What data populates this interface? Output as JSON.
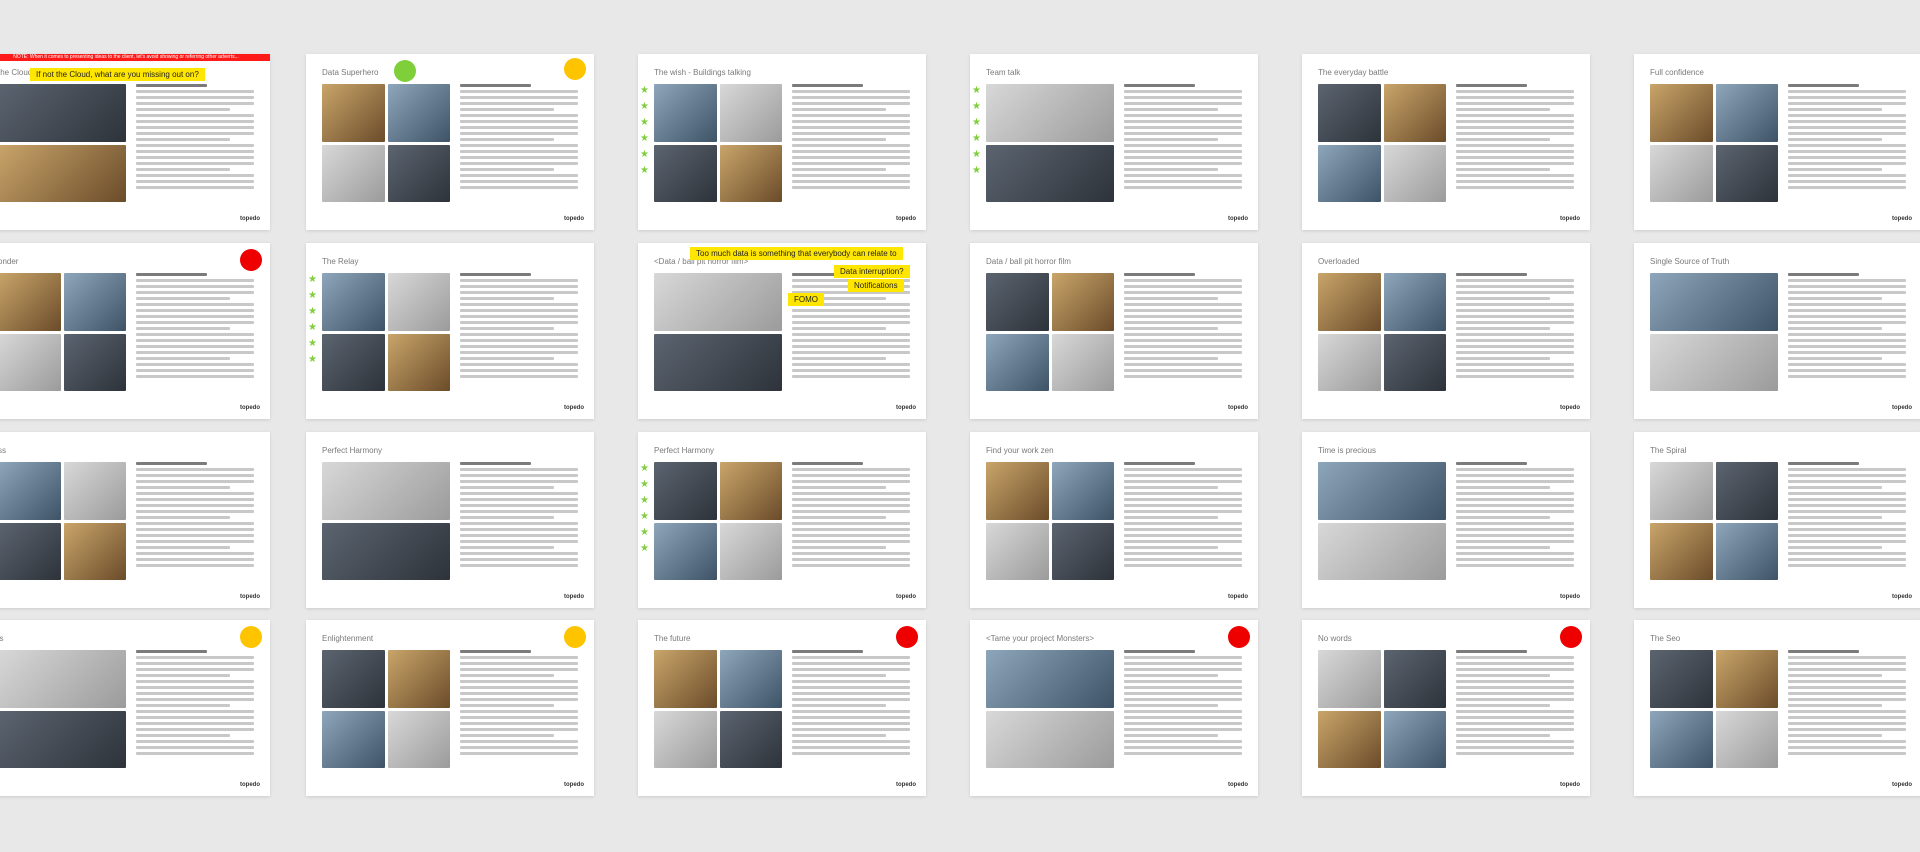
{
  "logo_text": "topedo",
  "rows": [
    {
      "slides": [
        {
          "title": "the Cloud",
          "variant": "cloud"
        },
        {
          "title": "Data Superhero",
          "variant": "superhero"
        },
        {
          "title": "The wish - Buildings talking",
          "variant": "stars"
        },
        {
          "title": "Team talk",
          "variant": "stars"
        },
        {
          "title": "The everyday battle",
          "variant": "plain"
        },
        {
          "title": "Full confidence",
          "variant": "plain"
        }
      ]
    },
    {
      "slides": [
        {
          "title": "onder",
          "variant": "dot-red"
        },
        {
          "title": "The Relay",
          "variant": "stars"
        },
        {
          "title": "<Data / ball pit horror film>",
          "variant": "fomo"
        },
        {
          "title": "Data / ball pit horror film",
          "variant": "plain"
        },
        {
          "title": "Overloaded",
          "variant": "plain"
        },
        {
          "title": "Single Source of Truth",
          "variant": "plain"
        }
      ]
    },
    {
      "slides": [
        {
          "title": "ss",
          "variant": "plain"
        },
        {
          "title": "Perfect Harmony",
          "variant": "plain"
        },
        {
          "title": "Perfect Harmony",
          "variant": "stars"
        },
        {
          "title": "Find your work zen",
          "variant": "plain"
        },
        {
          "title": "Time is precious",
          "variant": "plain"
        },
        {
          "title": "The Spiral",
          "variant": "plain"
        }
      ]
    },
    {
      "slides": [
        {
          "title": "'s",
          "variant": "dot-yellow"
        },
        {
          "title": "Enlightenment",
          "variant": "dot-yellow"
        },
        {
          "title": "The future",
          "variant": "dot-red"
        },
        {
          "title": "<Tame your project Monsters>",
          "variant": "dot-red"
        },
        {
          "title": "No words",
          "variant": "dot-red"
        },
        {
          "title": "The Seo",
          "variant": "plain"
        }
      ]
    }
  ],
  "cloud": {
    "notice": "NOTE: When it comes to presenting ideas to the client, let's avoid showing or referring other adverts...",
    "banner": "If not the Cloud, what are you missing out on?"
  },
  "fomo": {
    "headline": "Too much data is something that everybody can relate to",
    "tag_interruption": "Data interruption?",
    "tag_notifications": "Notifications",
    "tag_fomo": "FOMO"
  },
  "superhero": {
    "tag": "Data Superhero"
  },
  "colors": {
    "yellow": "#ffe600",
    "pink": "#f5a3e6",
    "purple": "#7e2fd0",
    "red": "#ee0000",
    "green": "#7ecf3a"
  }
}
